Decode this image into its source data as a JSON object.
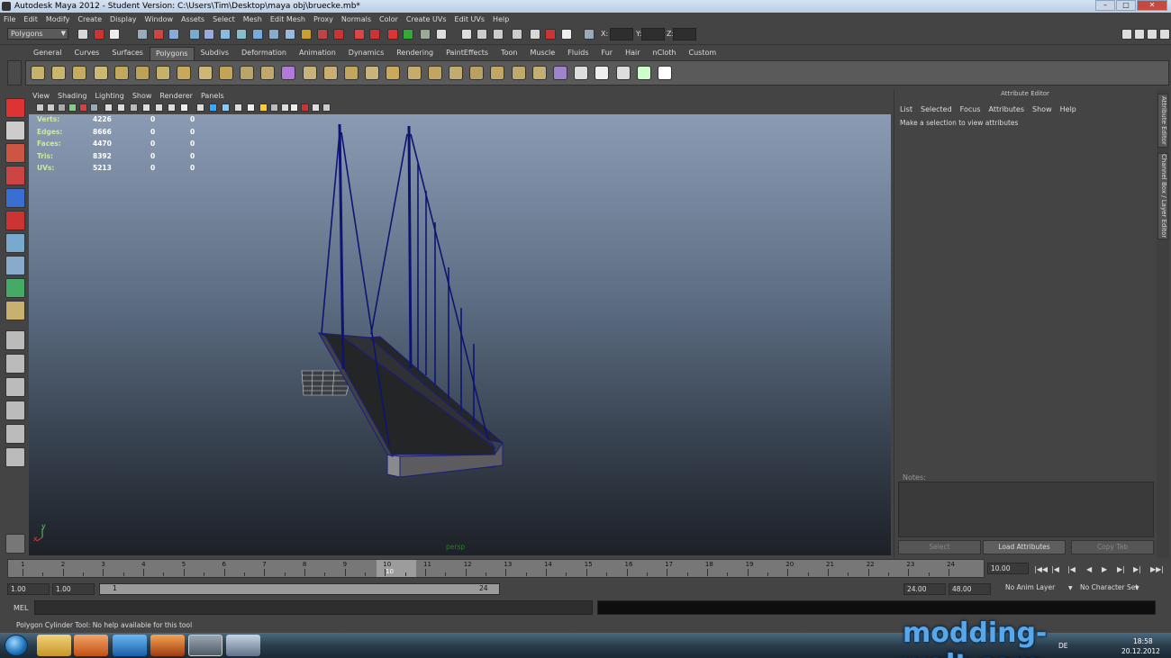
{
  "window": {
    "title": "Autodesk Maya 2012 - Student Version: C:\\Users\\Tim\\Desktop\\maya obj\\bruecke.mb*"
  },
  "menubar": [
    "File",
    "Edit",
    "Modify",
    "Create",
    "Display",
    "Window",
    "Assets",
    "Select",
    "Mesh",
    "Edit Mesh",
    "Proxy",
    "Normals",
    "Color",
    "Create UVs",
    "Edit UVs",
    "Help"
  ],
  "statusline": {
    "mode": "Polygons",
    "x_label": "X:",
    "y_label": "Y:",
    "z_label": "Z:"
  },
  "shelf_tabs": [
    "General",
    "Curves",
    "Surfaces",
    "Polygons",
    "Subdivs",
    "Deformation",
    "Animation",
    "Dynamics",
    "Rendering",
    "PaintEffects",
    "Toon",
    "Muscle",
    "Fluids",
    "Fur",
    "Hair",
    "nCloth",
    "Custom"
  ],
  "active_shelf_tab": "Polygons",
  "panel_menu": [
    "View",
    "Shading",
    "Lighting",
    "Show",
    "Renderer",
    "Panels"
  ],
  "hud": [
    {
      "label": "Verts:",
      "v1": "4226",
      "v2": "0",
      "v3": "0"
    },
    {
      "label": "Edges:",
      "v1": "8666",
      "v2": "0",
      "v3": "0"
    },
    {
      "label": "Faces:",
      "v1": "4470",
      "v2": "0",
      "v3": "0"
    },
    {
      "label": "Tris:",
      "v1": "8392",
      "v2": "0",
      "v3": "0"
    },
    {
      "label": "UVs:",
      "v1": "5213",
      "v2": "0",
      "v3": "0"
    }
  ],
  "viewport": {
    "camera_label": "persp",
    "axis_y": "y",
    "axis_x": "x"
  },
  "attribute_editor": {
    "title": "Attribute Editor",
    "menu": [
      "List",
      "Selected",
      "Focus",
      "Attributes",
      "Show",
      "Help"
    ],
    "message": "Make a selection to view attributes",
    "notes_label": "Notes:",
    "buttons": {
      "select": "Select",
      "load": "Load Attributes",
      "copy": "Copy Tab"
    }
  },
  "side_tabs": {
    "attribute_editor": "Attribute Editor",
    "channel_box": "Channel Box / Layer Editor"
  },
  "timeline": {
    "ticks": [
      "1",
      "2",
      "3",
      "4",
      "5",
      "6",
      "7",
      "8",
      "9",
      "10",
      "11",
      "12",
      "13",
      "14",
      "15",
      "16",
      "17",
      "18",
      "19",
      "20",
      "21",
      "22",
      "23",
      "24"
    ],
    "current_frame": "10",
    "current_time_field": "10.00"
  },
  "range": {
    "start": "1.00",
    "playback_start": "1.00",
    "range_start": "1",
    "range_end": "24",
    "playback_end": "24.00",
    "end": "48.00",
    "anim_layer": "No Anim Layer",
    "character_set": "No Character Set"
  },
  "mel": {
    "label": "MEL"
  },
  "help_line": "Polygon Cylinder Tool: No help available for this tool",
  "watermark": "modding-welt.com",
  "tray": {
    "lang": "DE",
    "time": "18:58",
    "date": "20.12.2012"
  }
}
